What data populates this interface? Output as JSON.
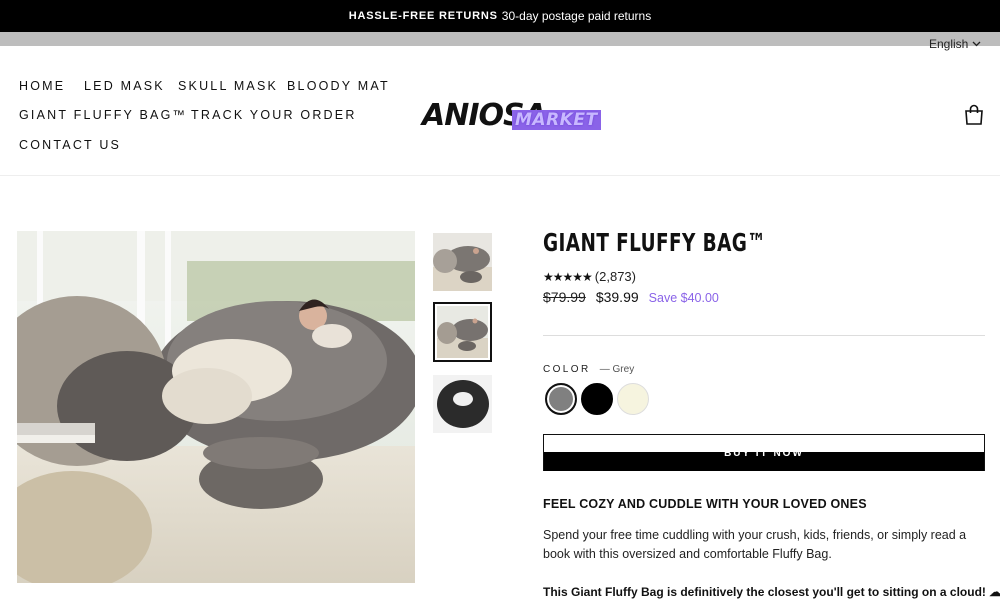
{
  "announcement": {
    "strong": "HASSLE-FREE RETURNS",
    "text": "30-day postage paid returns"
  },
  "language": {
    "label": "English",
    "icon": "chevron-down-icon"
  },
  "nav": {
    "home": "HOME",
    "led_mask": "LED MASK",
    "skull_mask": "SKULL MASK",
    "bloody_mat": "BLOODY MAT",
    "giant_fluffy_bag": "GIANT FLUFFY BAG™",
    "track_order": "TRACK YOUR ORDER",
    "contact": "CONTACT US"
  },
  "logo": {
    "main": "ANIOSA",
    "sub": "MARKET"
  },
  "header": {
    "cart_icon": "shopping-bag-icon"
  },
  "product": {
    "title": "GIANT FLUFFY BAG™",
    "stars": "★★★★★",
    "review_count": "(2,873)",
    "compare_price": "$79.99",
    "price": "$39.99",
    "save": "Save $40.00",
    "color_label": "COLOR",
    "color_value": "— Grey",
    "swatches": [
      {
        "name": "Grey",
        "hex": "#808080"
      },
      {
        "name": "Black",
        "hex": "#000000"
      },
      {
        "name": "Cream",
        "hex": "#f6f4df"
      }
    ],
    "buy_label": "BUY IT NOW",
    "heading": "FEEL COZY AND CUDDLE WITH YOUR LOVED ONES",
    "description": "Spend your free time cuddling with your crush, kids, friends, or simply read a book with this oversized and comfortable Fluffy Bag.",
    "bold_line": "This Giant Fluffy Bag is definitively the closest you'll get to sitting on a cloud! ☁"
  },
  "colors": {
    "accent": "#8a63e8",
    "black": "#000000"
  }
}
